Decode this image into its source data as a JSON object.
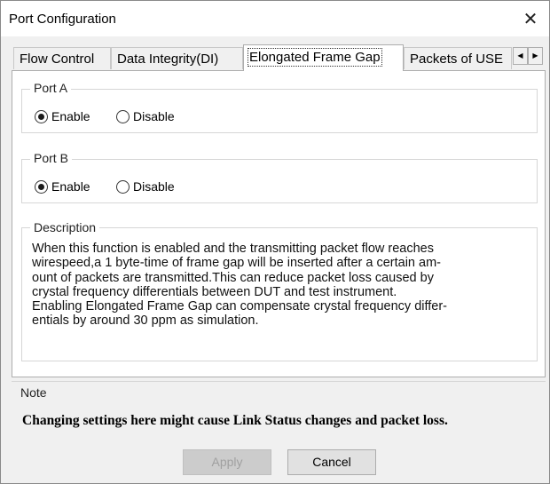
{
  "window": {
    "title": "Port Configuration",
    "close_glyph": "✕"
  },
  "tabs": [
    {
      "label": "Flow Control",
      "active": false
    },
    {
      "label": "Data Integrity(DI)",
      "active": false
    },
    {
      "label": "Elongated Frame Gap",
      "active": true
    },
    {
      "label": "Packets of USE",
      "active": false
    }
  ],
  "tab_scroll": {
    "left_glyph": "◀",
    "right_glyph": "▶"
  },
  "port_a": {
    "label": "Port A",
    "options": [
      {
        "label": "Enable",
        "checked": true
      },
      {
        "label": "Disable",
        "checked": false
      }
    ]
  },
  "port_b": {
    "label": "Port B",
    "options": [
      {
        "label": "Enable",
        "checked": true
      },
      {
        "label": "Disable",
        "checked": false
      }
    ]
  },
  "description": {
    "label": "Description",
    "lines": [
      "When this function is enabled and the transmitting packet flow reaches",
      "wirespeed,a 1 byte-time of frame gap will be inserted after a certain am-",
      "ount of packets are transmitted.This can reduce packet loss caused by",
      "crystal frequency differentials between DUT and test instrument.",
      "Enabling Elongated Frame Gap can compensate crystal frequency differ-",
      "entials by around 30 ppm as simulation."
    ]
  },
  "note": {
    "label": "Note",
    "text": "Changing settings here might cause Link Status changes and packet loss."
  },
  "buttons": {
    "apply": "Apply",
    "cancel": "Cancel"
  }
}
